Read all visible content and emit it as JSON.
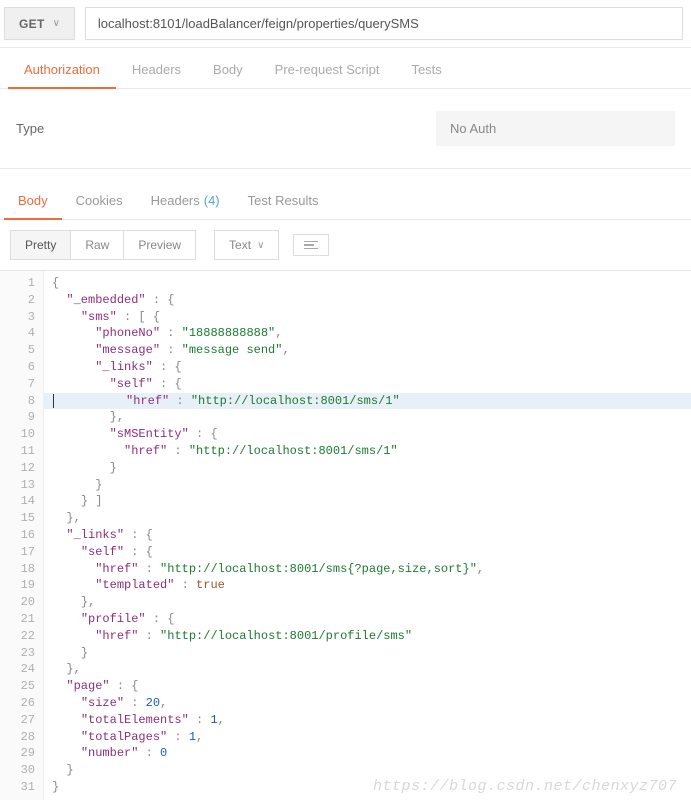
{
  "request": {
    "method": "GET",
    "url": "localhost:8101/loadBalancer/feign/properties/querySMS"
  },
  "tabs": {
    "items": [
      "Authorization",
      "Headers",
      "Body",
      "Pre-request Script",
      "Tests"
    ],
    "active": 0
  },
  "auth": {
    "type_label": "Type",
    "type_value": "No Auth"
  },
  "respTabs": {
    "items": [
      "Body",
      "Cookies",
      "Headers",
      "Test Results"
    ],
    "active": 0,
    "header_count": "(4)"
  },
  "viewBar": {
    "modes": [
      "Pretty",
      "Raw",
      "Preview"
    ],
    "active": 0,
    "format": "Text"
  },
  "code": {
    "highlight_line": 8,
    "lines": [
      [
        [
          "brace",
          "{"
        ]
      ],
      [
        [
          "ind",
          "  "
        ],
        [
          "key",
          "\"_embedded\""
        ],
        [
          "punc",
          " : "
        ],
        [
          "brace",
          "{"
        ]
      ],
      [
        [
          "ind",
          "    "
        ],
        [
          "key",
          "\"sms\""
        ],
        [
          "punc",
          " : [ "
        ],
        [
          "brace",
          "{"
        ]
      ],
      [
        [
          "ind",
          "      "
        ],
        [
          "key",
          "\"phoneNo\""
        ],
        [
          "punc",
          " : "
        ],
        [
          "str",
          "\"18888888888\""
        ],
        [
          "punc",
          ","
        ]
      ],
      [
        [
          "ind",
          "      "
        ],
        [
          "key",
          "\"message\""
        ],
        [
          "punc",
          " : "
        ],
        [
          "str",
          "\"message send\""
        ],
        [
          "punc",
          ","
        ]
      ],
      [
        [
          "ind",
          "      "
        ],
        [
          "key",
          "\"_links\""
        ],
        [
          "punc",
          " : "
        ],
        [
          "brace",
          "{"
        ]
      ],
      [
        [
          "ind",
          "        "
        ],
        [
          "key",
          "\"self\""
        ],
        [
          "punc",
          " : "
        ],
        [
          "brace",
          "{"
        ]
      ],
      [
        [
          "ind",
          "          "
        ],
        [
          "key",
          "\"href\""
        ],
        [
          "punc",
          " : "
        ],
        [
          "str",
          "\"http://localhost:8001/sms/1\""
        ]
      ],
      [
        [
          "ind",
          "        "
        ],
        [
          "brace",
          "}"
        ],
        [
          "punc",
          ","
        ]
      ],
      [
        [
          "ind",
          "        "
        ],
        [
          "key",
          "\"sMSEntity\""
        ],
        [
          "punc",
          " : "
        ],
        [
          "brace",
          "{"
        ]
      ],
      [
        [
          "ind",
          "          "
        ],
        [
          "key",
          "\"href\""
        ],
        [
          "punc",
          " : "
        ],
        [
          "str",
          "\"http://localhost:8001/sms/1\""
        ]
      ],
      [
        [
          "ind",
          "        "
        ],
        [
          "brace",
          "}"
        ]
      ],
      [
        [
          "ind",
          "      "
        ],
        [
          "brace",
          "}"
        ]
      ],
      [
        [
          "ind",
          "    "
        ],
        [
          "brace",
          "}"
        ],
        [
          "punc",
          " ]"
        ]
      ],
      [
        [
          "ind",
          "  "
        ],
        [
          "brace",
          "}"
        ],
        [
          "punc",
          ","
        ]
      ],
      [
        [
          "ind",
          "  "
        ],
        [
          "key",
          "\"_links\""
        ],
        [
          "punc",
          " : "
        ],
        [
          "brace",
          "{"
        ]
      ],
      [
        [
          "ind",
          "    "
        ],
        [
          "key",
          "\"self\""
        ],
        [
          "punc",
          " : "
        ],
        [
          "brace",
          "{"
        ]
      ],
      [
        [
          "ind",
          "      "
        ],
        [
          "key",
          "\"href\""
        ],
        [
          "punc",
          " : "
        ],
        [
          "str",
          "\"http://localhost:8001/sms{?page,size,sort}\""
        ],
        [
          "punc",
          ","
        ]
      ],
      [
        [
          "ind",
          "      "
        ],
        [
          "key",
          "\"templated\""
        ],
        [
          "punc",
          " : "
        ],
        [
          "bool",
          "true"
        ]
      ],
      [
        [
          "ind",
          "    "
        ],
        [
          "brace",
          "}"
        ],
        [
          "punc",
          ","
        ]
      ],
      [
        [
          "ind",
          "    "
        ],
        [
          "key",
          "\"profile\""
        ],
        [
          "punc",
          " : "
        ],
        [
          "brace",
          "{"
        ]
      ],
      [
        [
          "ind",
          "      "
        ],
        [
          "key",
          "\"href\""
        ],
        [
          "punc",
          " : "
        ],
        [
          "str",
          "\"http://localhost:8001/profile/sms\""
        ]
      ],
      [
        [
          "ind",
          "    "
        ],
        [
          "brace",
          "}"
        ]
      ],
      [
        [
          "ind",
          "  "
        ],
        [
          "brace",
          "}"
        ],
        [
          "punc",
          ","
        ]
      ],
      [
        [
          "ind",
          "  "
        ],
        [
          "key",
          "\"page\""
        ],
        [
          "punc",
          " : "
        ],
        [
          "brace",
          "{"
        ]
      ],
      [
        [
          "ind",
          "    "
        ],
        [
          "key",
          "\"size\""
        ],
        [
          "punc",
          " : "
        ],
        [
          "num",
          "20"
        ],
        [
          "punc",
          ","
        ]
      ],
      [
        [
          "ind",
          "    "
        ],
        [
          "key",
          "\"totalElements\""
        ],
        [
          "punc",
          " : "
        ],
        [
          "num",
          "1"
        ],
        [
          "punc",
          ","
        ]
      ],
      [
        [
          "ind",
          "    "
        ],
        [
          "key",
          "\"totalPages\""
        ],
        [
          "punc",
          " : "
        ],
        [
          "num",
          "1"
        ],
        [
          "punc",
          ","
        ]
      ],
      [
        [
          "ind",
          "    "
        ],
        [
          "key",
          "\"number\""
        ],
        [
          "punc",
          " : "
        ],
        [
          "num",
          "0"
        ]
      ],
      [
        [
          "ind",
          "  "
        ],
        [
          "brace",
          "}"
        ]
      ],
      [
        [
          "brace",
          "}"
        ]
      ]
    ]
  },
  "watermark": "https://blog.csdn.net/chenxyz707"
}
